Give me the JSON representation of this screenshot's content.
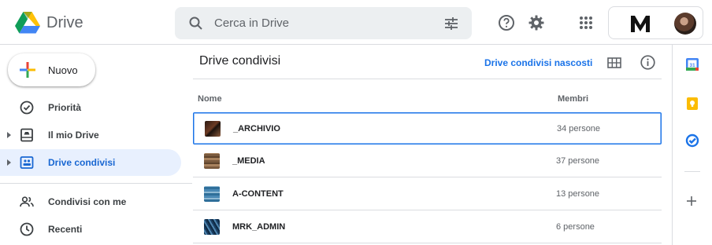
{
  "header": {
    "app_name": "Drive",
    "search_placeholder": "Cerca in Drive"
  },
  "sidebar": {
    "new_button_label": "Nuovo",
    "items": [
      {
        "label": "Priorità",
        "icon": "priority-icon",
        "active": false
      },
      {
        "label": "Il mio Drive",
        "icon": "my-drive-icon",
        "active": false
      },
      {
        "label": "Drive condivisi",
        "icon": "shared-drives-icon",
        "active": true
      },
      {
        "label": "Condivisi con me",
        "icon": "people-icon",
        "active": false
      },
      {
        "label": "Recenti",
        "icon": "clock-icon",
        "active": false
      }
    ]
  },
  "main": {
    "title": "Drive condivisi",
    "hidden_link": "Drive condivisi nascosti",
    "columns": {
      "name": "Nome",
      "members": "Membri"
    },
    "rows": [
      {
        "name": "_ARCHIVIO",
        "members": "34 persone",
        "selected": true
      },
      {
        "name": "_MEDIA",
        "members": "37 persone",
        "selected": false
      },
      {
        "name": "A-CONTENT",
        "members": "13 persone",
        "selected": false
      },
      {
        "name": "MRK_ADMIN",
        "members": "6 persone",
        "selected": false
      }
    ]
  },
  "colors": {
    "accent": "#1a73e8",
    "active_bg": "#e8f0fe",
    "search_bg": "#eceff1"
  }
}
